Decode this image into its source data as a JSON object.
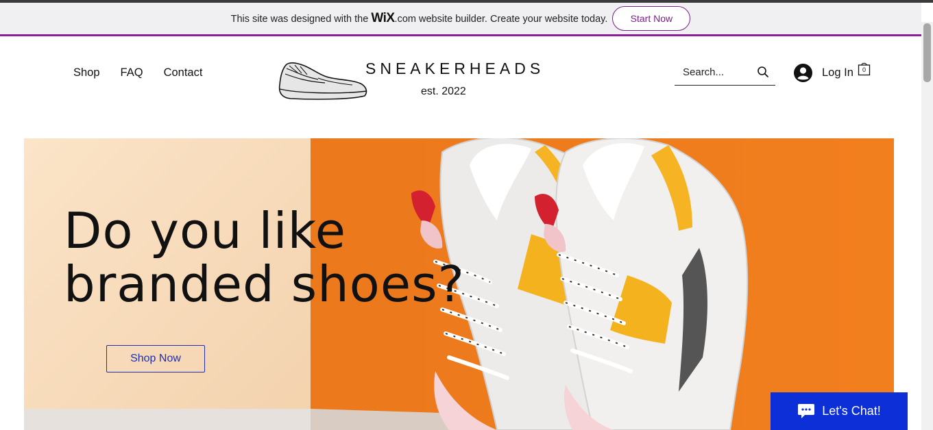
{
  "banner": {
    "text_before": "This site was designed with the ",
    "logo": "WiX",
    "logo_suffix": ".com",
    "text_after": " website builder. Create your website today.",
    "cta_label": "Start Now"
  },
  "header": {
    "nav": [
      "Shop",
      "FAQ",
      "Contact"
    ],
    "brand_name": "SNEAKERHEADS",
    "brand_tagline": "est. 2022",
    "search_placeholder": "Search...",
    "login_label": "Log In",
    "cart_count": "0"
  },
  "hero": {
    "title_line1": "Do you like",
    "title_line2": "branded shoes?",
    "cta_label": "Shop Now"
  },
  "chat": {
    "label": "Let's Chat!"
  },
  "colors": {
    "banner_accent": "#8e1b9a",
    "hero_orange": "#f08020",
    "hero_cream": "#f6dcbf",
    "button_blue": "#1f2fb0",
    "chat_blue": "#0c2fd7"
  }
}
